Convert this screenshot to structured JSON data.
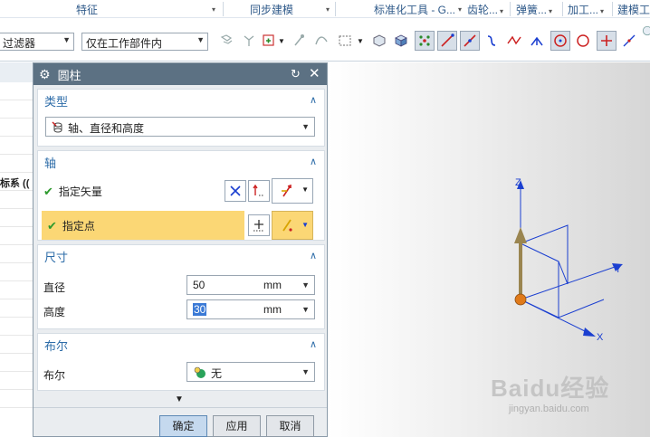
{
  "ribbon": {
    "groups": [
      "特征",
      "同步建模",
      "标准化工具 - G...",
      "齿轮...",
      "弹簧...",
      "加工...",
      "建模工具"
    ]
  },
  "toolbar": {
    "filter_combo": "过滤器",
    "scope_combo": "仅在工作部件内"
  },
  "left_panel": {
    "rows": [
      "",
      "",
      "",
      "",
      "",
      "标系 (("
    ]
  },
  "dialog": {
    "title": "圆柱",
    "type_section": {
      "header": "类型",
      "value": "轴、直径和高度"
    },
    "axis_section": {
      "header": "轴",
      "specify_vector_label": "指定矢量",
      "specify_point_label": "指定点"
    },
    "dimensions_section": {
      "header": "尺寸",
      "diameter_label": "直径",
      "diameter_value": "50",
      "diameter_unit": "mm",
      "height_label": "高度",
      "height_value": "30",
      "height_unit": "mm"
    },
    "boolean_section": {
      "header": "布尔",
      "label": "布尔",
      "value": "无"
    },
    "buttons": {
      "ok": "确定",
      "apply": "应用",
      "cancel": "取消"
    }
  },
  "viewport": {
    "axis_labels": {
      "x": "X",
      "y": "Y",
      "z": "Z"
    },
    "watermark": "Baidu经验",
    "watermark_url": "jingyan.baidu.com"
  },
  "colors": {
    "dialog_title_bg": "#5c7183",
    "section_header": "#2d6ca8",
    "highlight_row": "#fbd775",
    "axis_blue": "#1b3fd0"
  }
}
